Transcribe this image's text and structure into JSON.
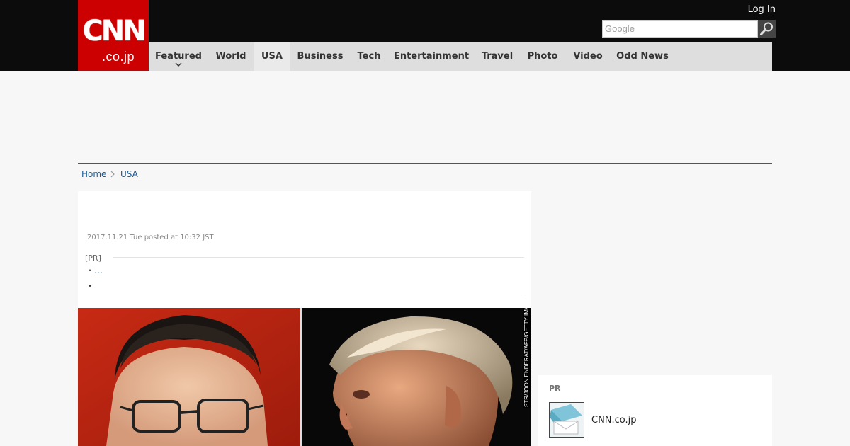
{
  "header": {
    "logo_main": "CNN",
    "logo_sub": ".co.jp",
    "login_label": "Log In",
    "search_placeholder": "Google"
  },
  "nav": {
    "items": [
      {
        "label": "Featured",
        "has_dropdown": true
      },
      {
        "label": "World"
      },
      {
        "label": "USA",
        "active": true
      },
      {
        "label": "Business"
      },
      {
        "label": "Tech"
      },
      {
        "label": "Entertainment"
      },
      {
        "label": "Travel"
      },
      {
        "label": "Photo"
      },
      {
        "label": "Video"
      },
      {
        "label": "Odd News"
      }
    ]
  },
  "breadcrumb": {
    "home": "Home",
    "current": "USA"
  },
  "article": {
    "dateline": "2017.11.21 Tue posted at 10:32 JST",
    "pr_label": "[PR]",
    "pr_bullet": "・",
    "pr_link": "…",
    "image_credit": "STR/JOON ENDERAT/AFP/GETTY IMAGES"
  },
  "sidebar": {
    "pr_heading": "PR",
    "pr_link": "CNN.co.jp"
  },
  "colors": {
    "brand_red": "#cc0000",
    "topbar": "#0c0c0c",
    "nav_bg": "#dedede",
    "link": "#1a5a96"
  }
}
